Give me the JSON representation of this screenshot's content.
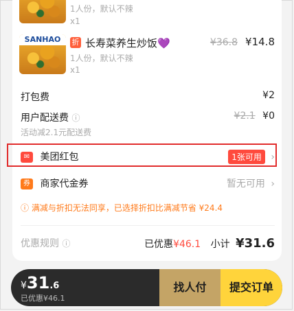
{
  "items": [
    {
      "brand": "",
      "meta_line": "1人份，默认不辣",
      "qty": "x1"
    },
    {
      "badge": "折",
      "name": "长寿菜养生炒饭💜",
      "brand": "SANHAO",
      "meta_line": "1人份，默认不辣",
      "qty": "x1",
      "old_price": "¥36.8",
      "new_price": "¥14.8"
    }
  ],
  "packing_fee": {
    "label": "打包费",
    "value": "¥2"
  },
  "delivery": {
    "label": "用户配送费",
    "info_icon": "ⓘ",
    "old": "¥2.1",
    "new": "¥0",
    "note": "活动减2.1元配送费"
  },
  "red_packet": {
    "icon": "red-packet-icon",
    "label": "美团红包",
    "pill": "1张可用"
  },
  "merchant_coupon": {
    "icon": "券",
    "label": "商家代金券",
    "status": "暂无可用"
  },
  "notice": "满减与折扣无法同享，已选择折扣比满减节省 ¥24.4",
  "summary": {
    "rules_label": "优惠规则",
    "discount_label": "已优惠",
    "discount_value": "¥46.1",
    "subtotal_label": "小计",
    "subtotal_value": "¥31.6"
  },
  "checkout": {
    "currency": "¥",
    "int": "31",
    "dec": ".6",
    "saved_text": "已优惠¥46.1",
    "friend_btn": "找人付",
    "submit_btn": "提交订单"
  },
  "colors": {
    "accent_red": "#ff4a3d",
    "highlight_border": "#e12b2b",
    "submit_yellow": "#ffd43b",
    "friend_gold": "#c4a466"
  }
}
